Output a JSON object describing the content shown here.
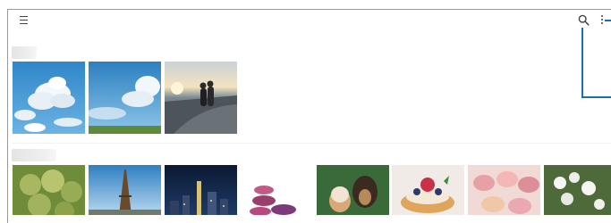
{
  "toolbar": {
    "menu_icon": "hamburger-menu-icon",
    "search_icon": "search-icon",
    "more_icon": "more-options-icon"
  },
  "albums": [
    {
      "title": "",
      "items": [
        "clouds-photo",
        "sky-photo",
        "couple-photo"
      ]
    },
    {
      "title": "",
      "items": [
        "green-fruit-photo",
        "eiffel-tower-photo",
        "city-night-photo",
        "macarons-photo",
        "puppy-kitten-photo",
        "berry-tart-photo",
        "macarons-closeup-photo",
        "white-flowers-photo"
      ]
    }
  ],
  "colors": {
    "callout": "#1b6fa8",
    "frame": "#9a9a9a"
  }
}
